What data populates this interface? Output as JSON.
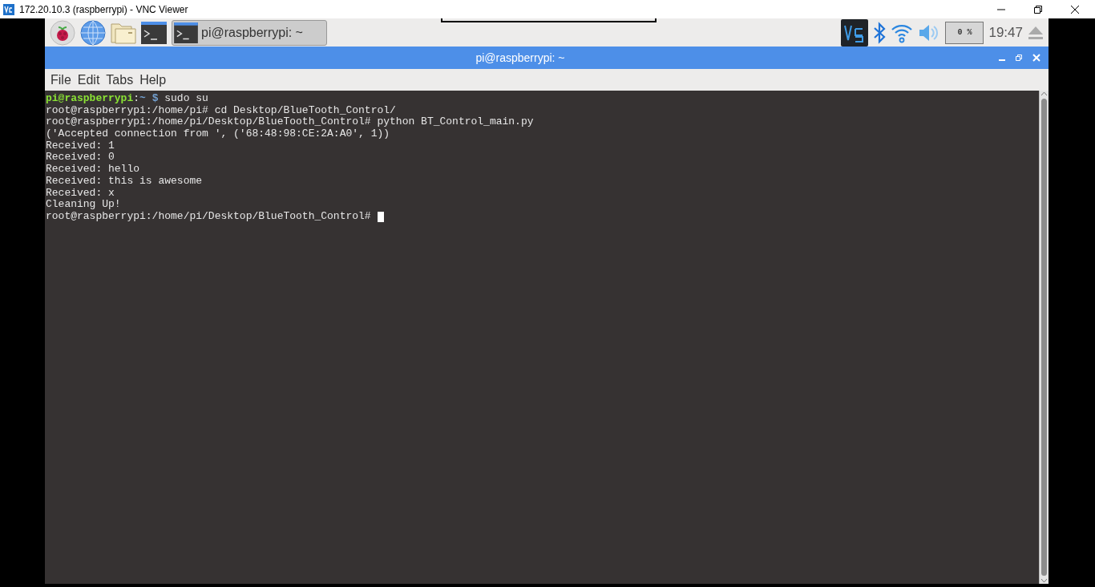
{
  "viewer": {
    "title": "172.20.10.3 (raspberrypi) - VNC Viewer"
  },
  "taskbar": {
    "window_button": {
      "label": "pi@raspberrypi: ~",
      "selected": true
    },
    "cpu": "0 %",
    "clock": "19:47"
  },
  "terminal": {
    "title": "pi@raspberrypi: ~",
    "menu": [
      "File",
      "Edit",
      "Tabs",
      "Help"
    ],
    "lines": [
      {
        "kind": "prompt",
        "user": "pi@raspberrypi",
        "sep": ":",
        "path": "~",
        "symbol": "$",
        "command": "sudo su"
      },
      {
        "kind": "output",
        "text": "root@raspberrypi:/home/pi# cd Desktop/BlueTooth_Control/"
      },
      {
        "kind": "output",
        "text": "root@raspberrypi:/home/pi/Desktop/BlueTooth_Control# python BT_Control_main.py"
      },
      {
        "kind": "output",
        "text": "('Accepted connection from ', ('68:48:98:CE:2A:A0', 1))"
      },
      {
        "kind": "output",
        "text": "Received: 1"
      },
      {
        "kind": "output",
        "text": "Received: 0"
      },
      {
        "kind": "output",
        "text": "Received: hello"
      },
      {
        "kind": "output",
        "text": "Received: this is awesome"
      },
      {
        "kind": "output",
        "text": "Received: x"
      },
      {
        "kind": "output",
        "text": "Cleaning Up!"
      },
      {
        "kind": "output",
        "text": "root@raspberrypi:/home/pi/Desktop/BlueTooth_Control#",
        "cursor": true
      }
    ]
  }
}
